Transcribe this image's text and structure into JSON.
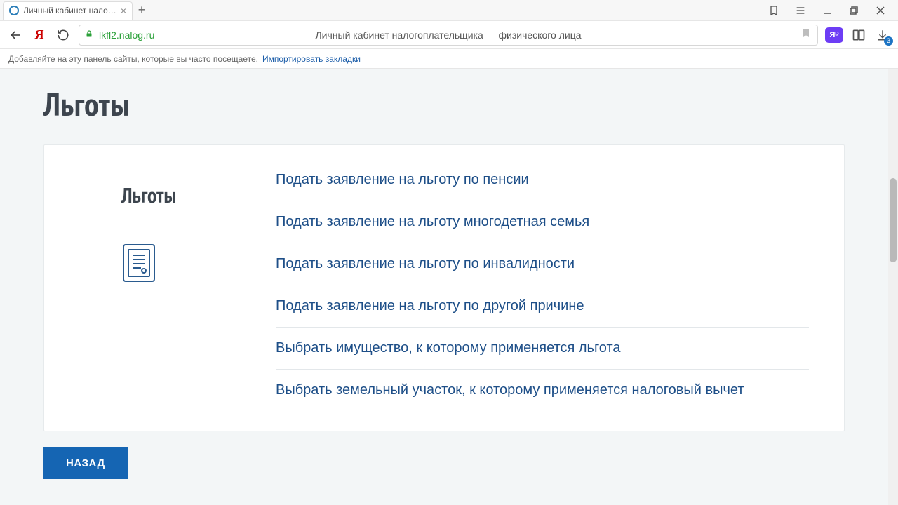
{
  "browser": {
    "tab_title": "Личный кабинет налог…",
    "url": "lkfl2.nalog.ru",
    "page_description": "Личный кабинет налогоплательщика — физического лица",
    "bookmarks_hint": "Добавляйте на эту панель сайты, которые вы часто посещаете.",
    "bookmarks_import": "Импортировать закладки",
    "downloads_count": "3"
  },
  "page": {
    "title": "Льготы",
    "card_title": "Льготы",
    "links": [
      "Подать заявление на льготу по пенсии",
      "Подать заявление на льготу многодетная семья",
      "Подать заявление на льготу по инвалидности",
      "Подать заявление на льготу по другой причине",
      "Выбрать имущество, к которому применяется льгота",
      "Выбрать земельный участок, к которому применяется налоговый вычет"
    ],
    "back_label": "НАЗАД"
  }
}
